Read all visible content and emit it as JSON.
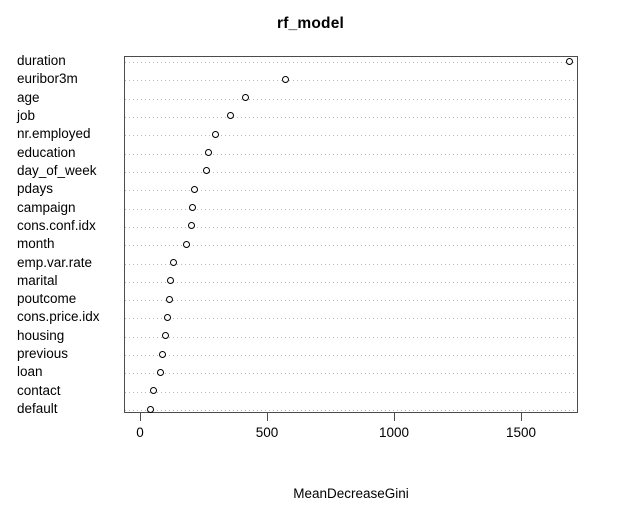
{
  "chart_data": {
    "type": "scatter",
    "title": "rf_model",
    "xlabel": "MeanDecreaseGini",
    "ylabel": "",
    "grid": true,
    "legend": null,
    "xlim": [
      0,
      1750
    ],
    "x_ticks": [
      {
        "value": 0,
        "label": "0"
      },
      {
        "value": 500,
        "label": "500"
      },
      {
        "value": 1000,
        "label": "1000"
      },
      {
        "value": 1500,
        "label": "1500"
      }
    ],
    "categories": [
      "duration",
      "euribor3m",
      "age",
      "job",
      "nr.employed",
      "education",
      "day_of_week",
      "pdays",
      "campaign",
      "cons.conf.idx",
      "month",
      "emp.var.rate",
      "marital",
      "poutcome",
      "cons.price.idx",
      "housing",
      "previous",
      "loan",
      "contact",
      "default"
    ],
    "values": [
      1690,
      571,
      417,
      358,
      299,
      268,
      260,
      213,
      205,
      201,
      185,
      130,
      122,
      118,
      110,
      99,
      87,
      79,
      55,
      43
    ]
  },
  "axis": {
    "x_title": "MeanDecreaseGini"
  }
}
